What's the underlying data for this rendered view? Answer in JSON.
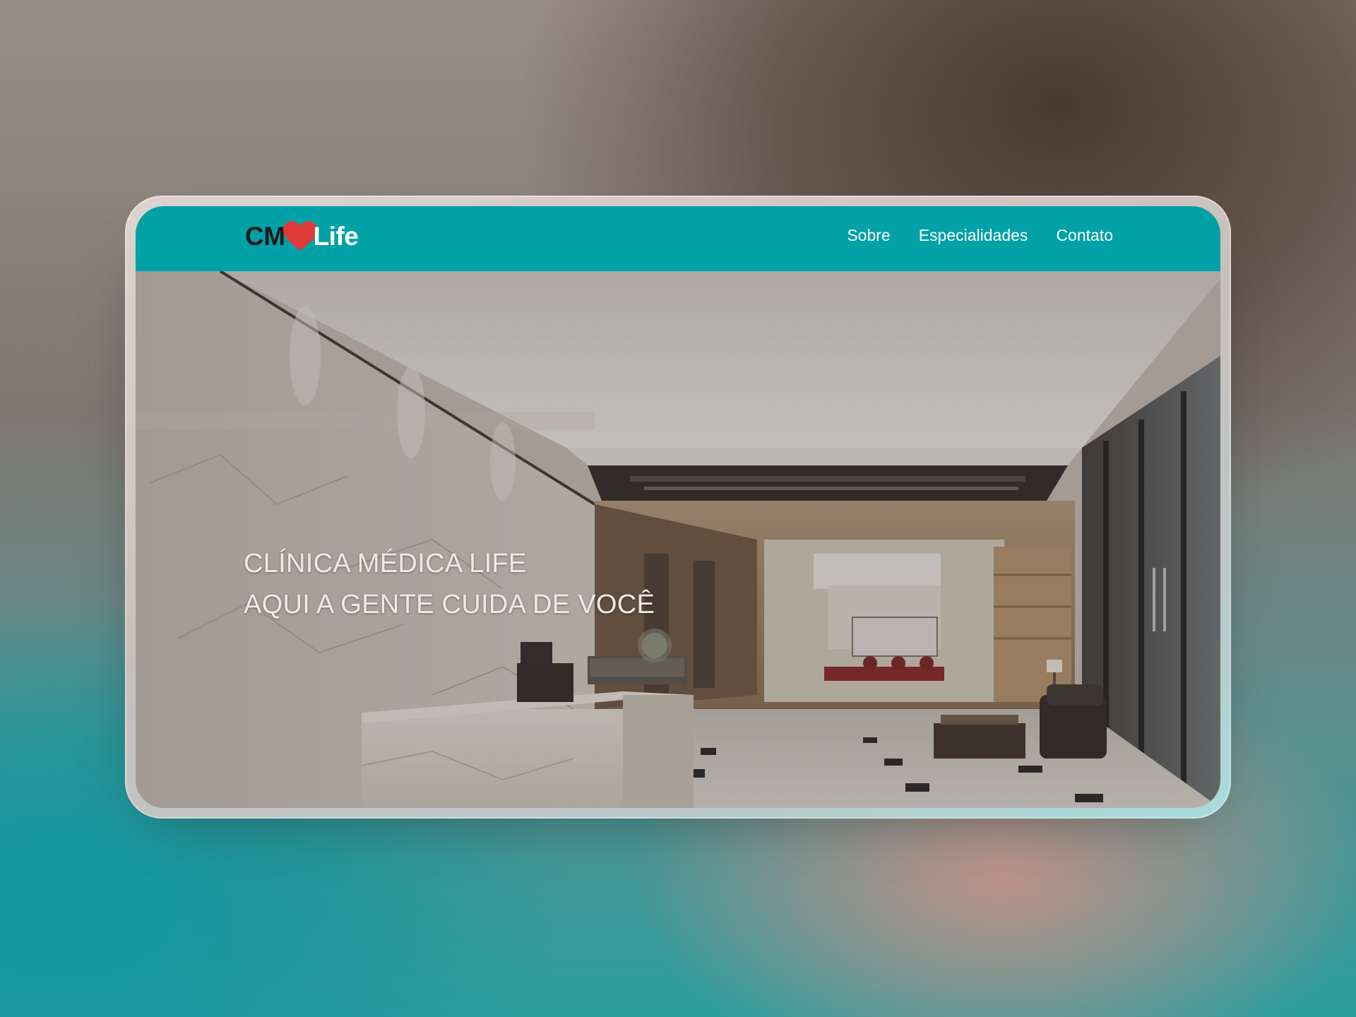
{
  "brand": {
    "logo_prefix": "CM",
    "logo_suffix": "Life",
    "heart_color": "#e03a3a",
    "primary_color": "#00a1a7"
  },
  "nav": {
    "links": [
      {
        "label": "Sobre"
      },
      {
        "label": "Especialidades"
      },
      {
        "label": "Contato"
      }
    ]
  },
  "hero": {
    "title_line1": "CLÍNICA MÉDICA LIFE",
    "title_line2": "AQUI A GENTE CUIDA DE VOCÊ"
  }
}
